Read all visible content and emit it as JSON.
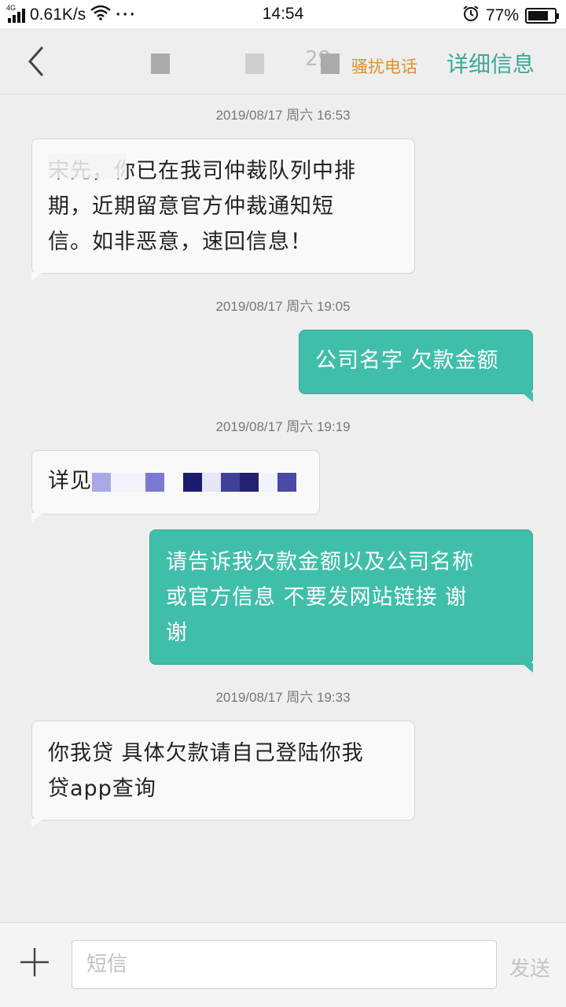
{
  "status_bar": {
    "network": "4G",
    "speed": "0.61K/s",
    "more": "···",
    "time": "14:54",
    "battery": "77%",
    "battery_level": 0.77
  },
  "header": {
    "number_fragment": "29",
    "harassment_tag": "骚扰电话",
    "details_link": "详细信息"
  },
  "messages": [
    {
      "timestamp": "2019/08/17  周六  16:53",
      "direction": "incoming",
      "lines": [
        "宋先，你已在我司仲裁队列中排",
        "期，近期留意官方仲裁通知短",
        "信。如非恶意，速回信息！"
      ]
    },
    {
      "timestamp": "2019/08/17  周六  19:05",
      "direction": "outgoing",
      "lines": [
        "公司名字  欠款金额"
      ]
    },
    {
      "timestamp": "2019/08/17  周六  19:19",
      "direction": "incoming",
      "prefix": "详见"
    },
    {
      "direction": "outgoing",
      "lines": [
        "请告诉我欠款金额以及公司名称",
        "或官方信息  不要发网站链接  谢",
        "谢"
      ]
    },
    {
      "timestamp": "2019/08/17  周六  19:33",
      "direction": "incoming",
      "lines": [
        "你我贷 具体欠款请自己登陆你我",
        "贷app查询"
      ]
    }
  ],
  "input_bar": {
    "placeholder": "短信",
    "send_label": "发送"
  },
  "colors": {
    "outgoing_bubble": "#3fbfaa",
    "incoming_bubble": "#f9f9f9",
    "accent": "#3aaa98",
    "harassment": "#e0902a"
  }
}
